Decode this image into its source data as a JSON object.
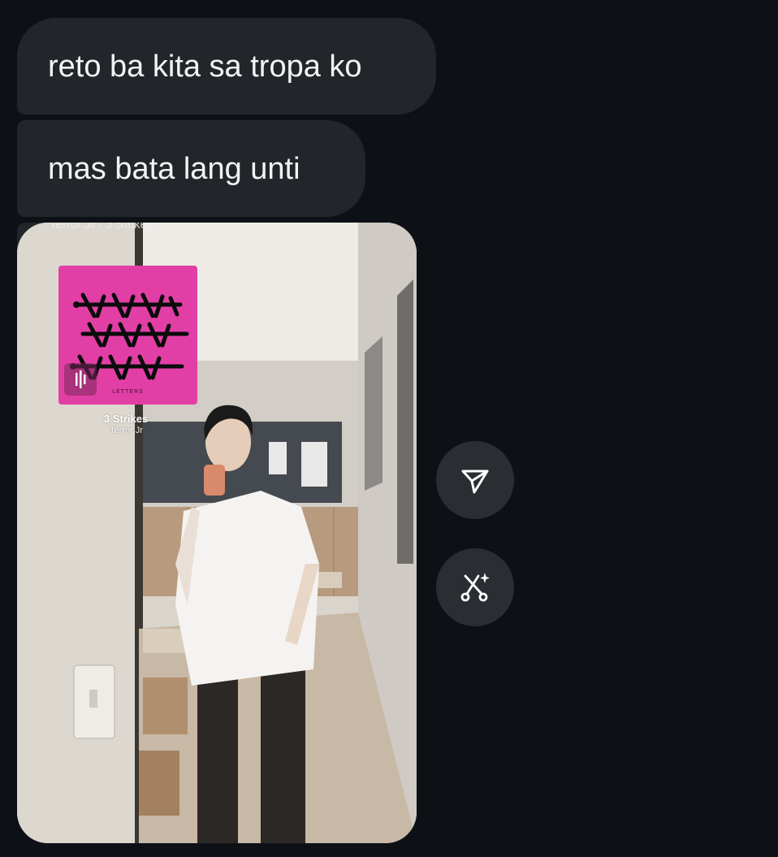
{
  "messages": [
    {
      "text": "reto ba kita sa tropa ko"
    },
    {
      "text": "mas bata lang unti"
    }
  ],
  "story": {
    "header": "Terror Jr · 3 Strikes",
    "song": {
      "title": "3 Strikes",
      "artist": "Terror Jr",
      "publisher": "LETTERS"
    },
    "album_color": "#e23fa6"
  },
  "actions": {
    "share_icon": "send-icon",
    "remix_icon": "scissors-sparkle-icon"
  },
  "colors": {
    "background": "#0d1116",
    "bubble": "#22262b",
    "bubble_text": "#f2f3f5",
    "action_button": "#2a2e33"
  }
}
